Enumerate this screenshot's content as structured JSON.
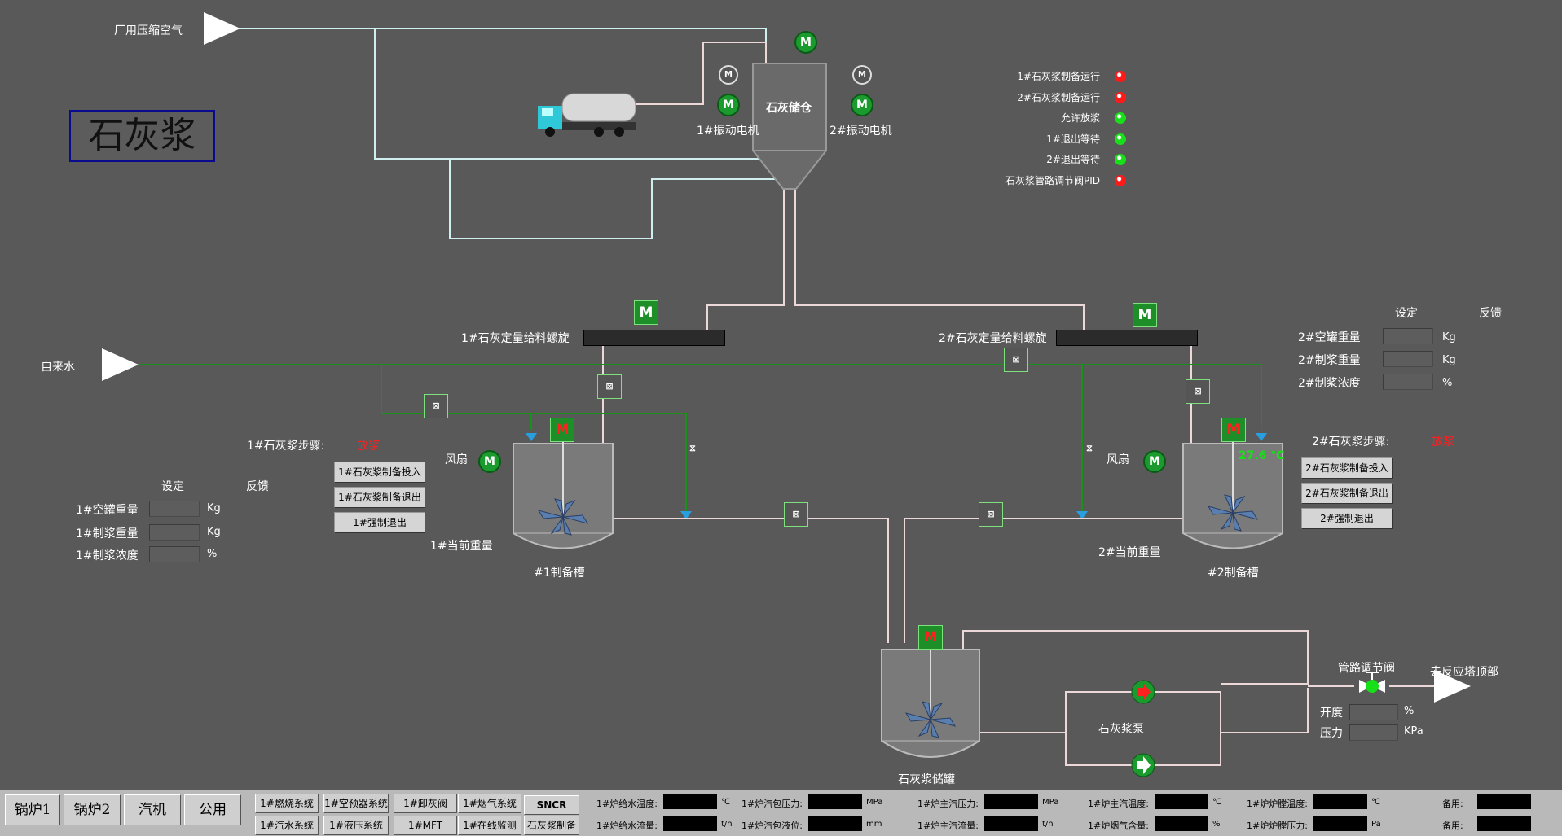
{
  "title": "石灰浆",
  "air_label": "厂用压缩空气",
  "water_label": "自来水",
  "silo": {
    "label": "石灰储仓",
    "vib1": "1#振动电机",
    "vib2": "2#振动电机"
  },
  "status_list": [
    {
      "label": "1#石灰浆制备运行",
      "color": "red"
    },
    {
      "label": "2#石灰浆制备运行",
      "color": "red"
    },
    {
      "label": "允许放浆",
      "color": "green"
    },
    {
      "label": "1#退出等待",
      "color": "green"
    },
    {
      "label": "2#退出等待",
      "color": "green"
    },
    {
      "label": "石灰浆管路调节阀PID",
      "color": "red"
    }
  ],
  "screw1": "1#石灰定量给料螺旋",
  "screw2": "2#石灰定量给料螺旋",
  "fan": "风扇",
  "motor_symbol": "M",
  "tank1": {
    "name": "#1制备槽",
    "weight": "1#当前重量"
  },
  "tank2": {
    "name": "#2制备槽",
    "weight": "2#当前重量",
    "temp": "27.6 ℃"
  },
  "storage": {
    "name": "石灰浆储罐"
  },
  "pump": "石灰浆泵",
  "valve": {
    "name": "管路调节阀",
    "to": "去反应塔顶部",
    "open_label": "开度",
    "open_unit": "%",
    "press_label": "压力",
    "press_unit": "KPa"
  },
  "left_panel": {
    "step_label": "1#石灰浆步骤:",
    "step_value": "放浆",
    "buttons": [
      "1#石灰浆制备投入",
      "1#石灰浆制备退出",
      "1#强制退出"
    ],
    "col_set": "设定",
    "col_fb": "反馈",
    "rows": [
      {
        "label": "1#空罐重量",
        "unit": "Kg"
      },
      {
        "label": "1#制浆重量",
        "unit": "Kg"
      },
      {
        "label": "1#制浆浓度",
        "unit": "%"
      }
    ]
  },
  "right_panel": {
    "step_label": "2#石灰浆步骤:",
    "step_value": "放浆",
    "buttons": [
      "2#石灰浆制备投入",
      "2#石灰浆制备退出",
      "2#强制退出"
    ],
    "col_set": "设定",
    "col_fb": "反馈",
    "rows": [
      {
        "label": "2#空罐重量",
        "unit": "Kg"
      },
      {
        "label": "2#制浆重量",
        "unit": "Kg"
      },
      {
        "label": "2#制浆浓度",
        "unit": "%"
      }
    ]
  },
  "nav_main": [
    "锅炉1",
    "锅炉2",
    "汽机",
    "公用"
  ],
  "nav_sub": [
    "1#燃烧系统",
    "1#汽水系统",
    "1#空预器系统",
    "1#液压系统",
    "1#卸灰阀",
    "1#MFT",
    "1#烟气系统",
    "1#在线监测",
    "SNCR",
    "石灰浆制备"
  ],
  "readouts": [
    {
      "label": "1#炉给水温度:",
      "unit": "℃"
    },
    {
      "label": "1#炉汽包压力:",
      "unit": "MPa"
    },
    {
      "label": "1#炉主汽压力:",
      "unit": "MPa"
    },
    {
      "label": "1#炉主汽温度:",
      "unit": "℃"
    },
    {
      "label": "1#炉炉膛温度:",
      "unit": "℃"
    },
    {
      "label": "备用:",
      "unit": ""
    },
    {
      "label": "1#炉给水流量:",
      "unit": "t/h"
    },
    {
      "label": "1#炉汽包液位:",
      "unit": "mm"
    },
    {
      "label": "1#炉主汽流量:",
      "unit": "t/h"
    },
    {
      "label": "1#炉烟气含量:",
      "unit": "%"
    },
    {
      "label": "1#炉炉膛压力:",
      "unit": "Pa"
    },
    {
      "label": "备用:",
      "unit": ""
    }
  ],
  "colors": {
    "bg": "#595959",
    "air_pipe": "#cfeeee",
    "water_pipe": "#1a8f1a",
    "slurry_pipe": "#ecd8d8",
    "motor_green": "#1b9a2e",
    "alarm_red": "#ff2020"
  }
}
